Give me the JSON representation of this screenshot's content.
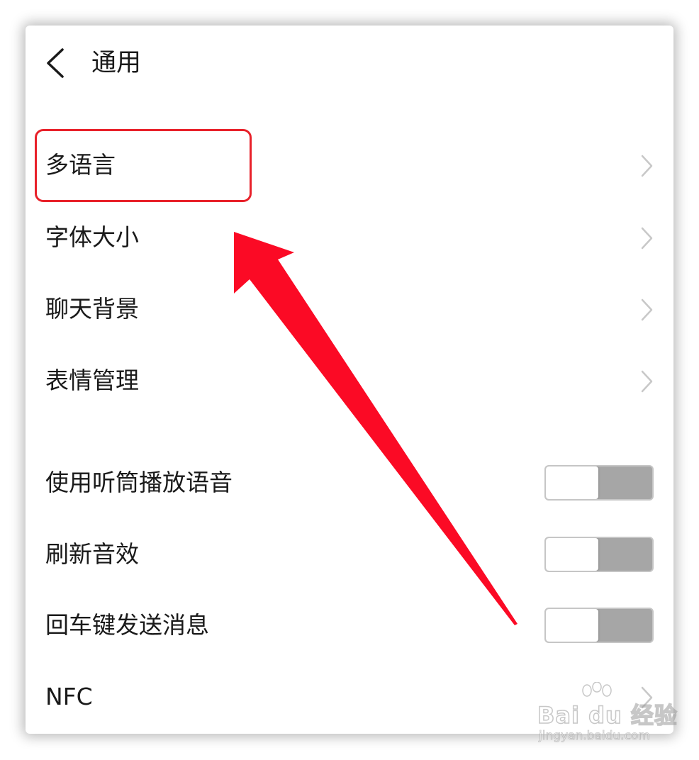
{
  "header": {
    "title": "通用",
    "back_icon": "chevron-left-icon"
  },
  "nav_items": [
    {
      "label": "多语言",
      "icon": "chevron-right-icon"
    },
    {
      "label": "字体大小",
      "icon": "chevron-right-icon"
    },
    {
      "label": "聊天背景",
      "icon": "chevron-right-icon"
    },
    {
      "label": "表情管理",
      "icon": "chevron-right-icon"
    }
  ],
  "toggle_items": [
    {
      "label": "使用听筒播放语音",
      "enabled": false
    },
    {
      "label": "刷新音效",
      "enabled": false
    },
    {
      "label": "回车键发送消息",
      "enabled": false
    }
  ],
  "bottom_item": {
    "label": "NFC",
    "icon": "chevron-right-icon"
  },
  "annotation": {
    "color": "#e8212a",
    "highlighted_item": "多语言"
  },
  "watermark": {
    "brand": "Bai du 经验",
    "url": "jingyan.baidu.com"
  },
  "colors": {
    "background": "#ffffff",
    "text": "#1a1a1a",
    "chevron": "#c8c8c8",
    "toggle_off_track": "#a6a6a6",
    "annotation_red": "#e8212a"
  }
}
